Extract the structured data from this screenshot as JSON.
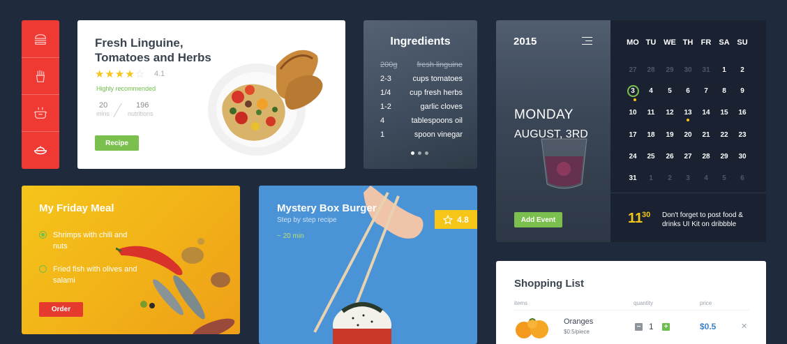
{
  "sidebar": {
    "items": [
      {
        "icon": "burger-icon"
      },
      {
        "icon": "fries-icon"
      },
      {
        "icon": "pot-icon"
      },
      {
        "icon": "dish-icon"
      }
    ]
  },
  "recipe": {
    "title_line1": "Fresh Linguine,",
    "title_line2": "Tomatoes and Herbs",
    "stars_on": "★★★★",
    "stars_off": "☆",
    "rating": "4.1",
    "recommendation": "Highly recommended",
    "time_value": "20",
    "time_label": "mins",
    "nutrition_value": "196",
    "nutrition_label": "nutritions",
    "button_label": "Recipe"
  },
  "ingredients": {
    "title": "Ingredients",
    "items": [
      {
        "qty": "200g",
        "name": "fresh linguine",
        "checked": true
      },
      {
        "qty": "2-3",
        "name": "cups tomatoes"
      },
      {
        "qty": "1/4",
        "name": "cup fresh herbs"
      },
      {
        "qty": "1-2",
        "name": "garlic cloves"
      },
      {
        "qty": "4",
        "name": "tablespoons oil"
      },
      {
        "qty": "1",
        "name": "spoon vinegar"
      }
    ]
  },
  "calendar": {
    "year": "2015",
    "weekday": "MONDAY",
    "date": "AUGUST, 3RD",
    "button_label": "Add Event",
    "headers": [
      "MO",
      "TU",
      "WE",
      "TH",
      "FR",
      "SA",
      "SU"
    ],
    "weeks": [
      [
        "27",
        "28",
        "29",
        "30",
        "31",
        "1",
        "2"
      ],
      [
        "3",
        "4",
        "5",
        "6",
        "7",
        "8",
        "9"
      ],
      [
        "10",
        "11",
        "12",
        "13",
        "14",
        "15",
        "16"
      ],
      [
        "17",
        "18",
        "19",
        "20",
        "21",
        "22",
        "23"
      ],
      [
        "24",
        "25",
        "26",
        "27",
        "28",
        "29",
        "30"
      ],
      [
        "31",
        "1",
        "2",
        "3",
        "4",
        "5",
        "6"
      ]
    ],
    "reminder_hour": "11",
    "reminder_minute": "30",
    "reminder_text": "Don't forget to post food & drinks UI Kit on dribbble",
    "accent_color": "#f5c518",
    "highlight_color": "#7bbf4e"
  },
  "meal": {
    "title": "My Friday Meal",
    "items": [
      {
        "label": "Shrimps  with chili and nuts",
        "selected": true
      },
      {
        "label": "Fried fish with olives and salami",
        "selected": false
      }
    ],
    "button_label": "Order"
  },
  "burger": {
    "title": "Mystery Box Burger",
    "subtitle": "Step by step recipe",
    "time": "~ 20 min",
    "rating_icon": "star-outline-icon",
    "rating": "4.8"
  },
  "shopping": {
    "title": "Shopping List",
    "col_items": "items",
    "col_quantity": "quantity",
    "col_price": "price",
    "rows": [
      {
        "name": "Oranges",
        "unit": "$0.5/piece",
        "minus": "−",
        "qty": "1",
        "plus": "+",
        "price": "$0.5",
        "remove": "✕"
      }
    ]
  }
}
